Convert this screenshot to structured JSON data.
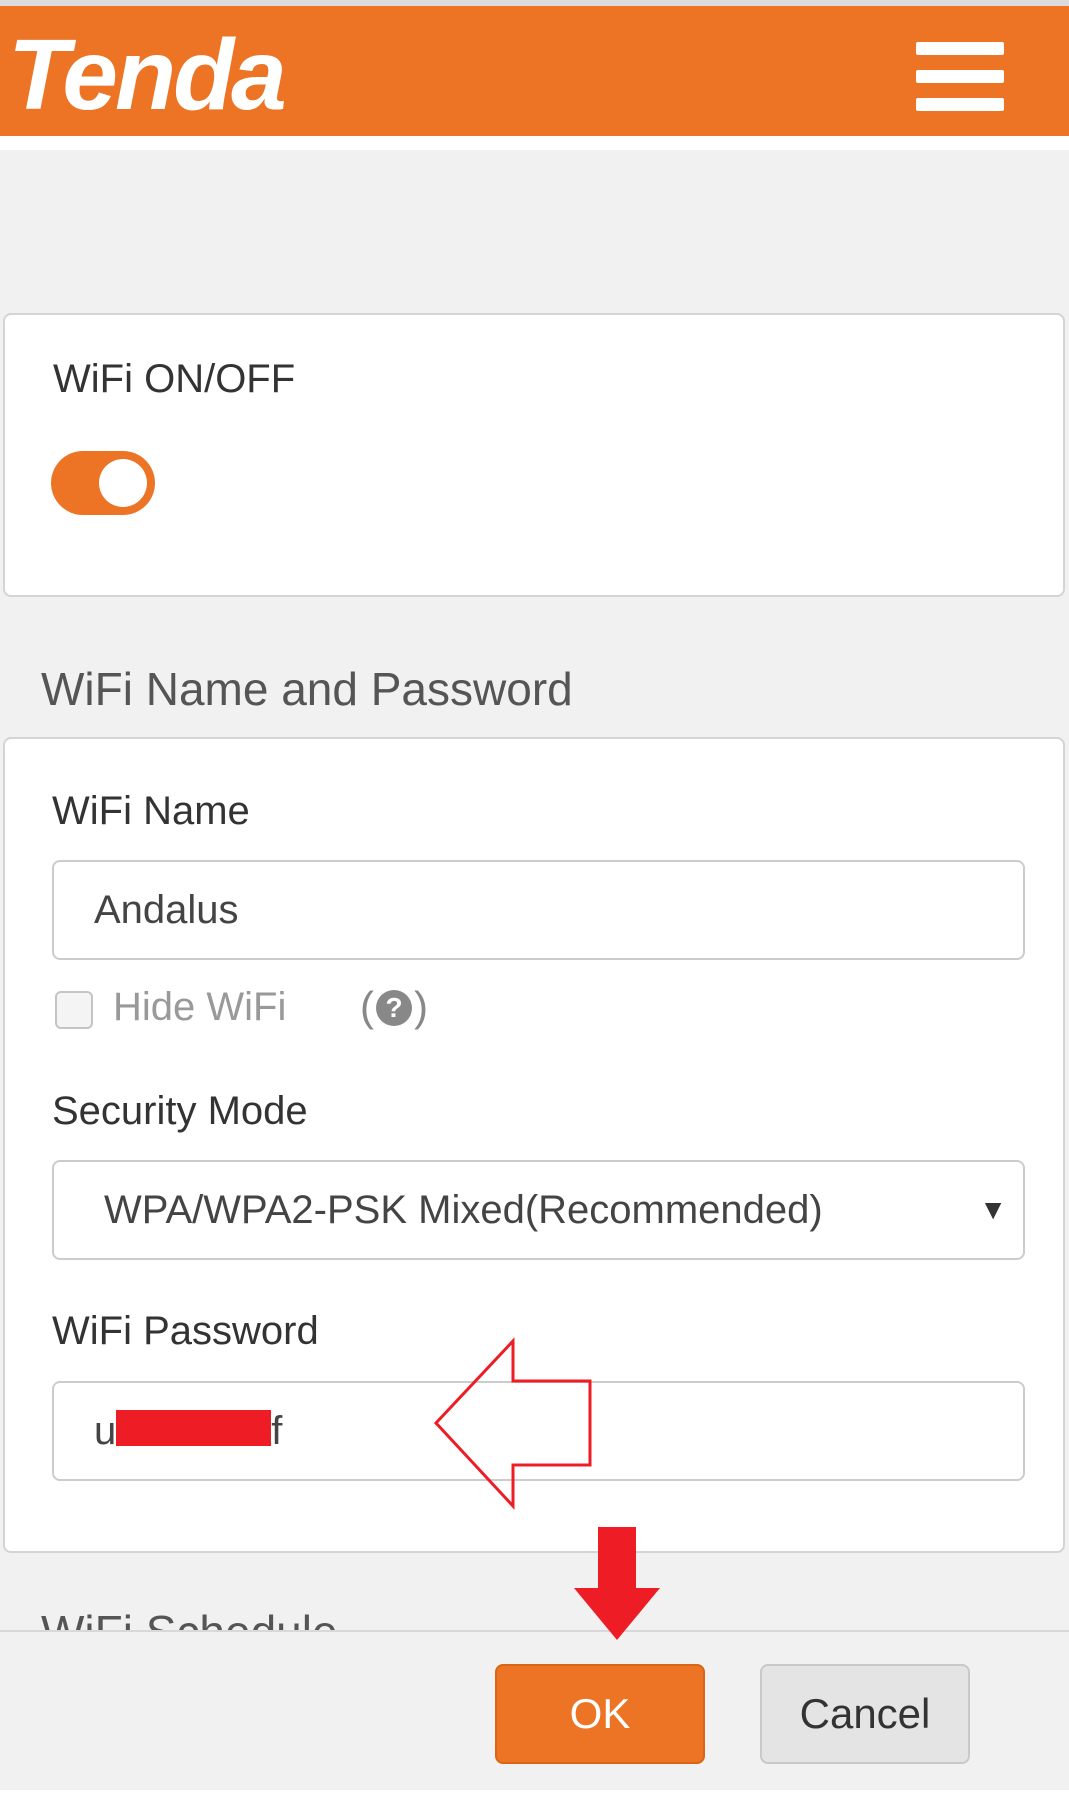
{
  "header": {
    "brand": "Tenda",
    "brand_color": "#ec7424",
    "menu_icon": "hamburger-menu-icon"
  },
  "wifi_switch": {
    "label": "WiFi ON/OFF",
    "state": "on"
  },
  "name_password": {
    "section_title": "WiFi Name and Password",
    "wifi_name_label": "WiFi Name",
    "wifi_name_value": "Andalus",
    "hide_wifi_label": "Hide WiFi",
    "hide_wifi_checked": false,
    "help_open": "(",
    "help_glyph": "?",
    "help_close": ")",
    "security_mode_label": "Security Mode",
    "security_mode_value": "WPA/WPA2-PSK Mixed(Recommended)",
    "password_label": "WiFi Password",
    "password_prefix": "u",
    "password_suffix": "f"
  },
  "next_section_title": "WiFi Schedule",
  "footer": {
    "ok_label": "OK",
    "cancel_label": "Cancel"
  },
  "annotations": {
    "arrow_color": "#ee1c25"
  }
}
